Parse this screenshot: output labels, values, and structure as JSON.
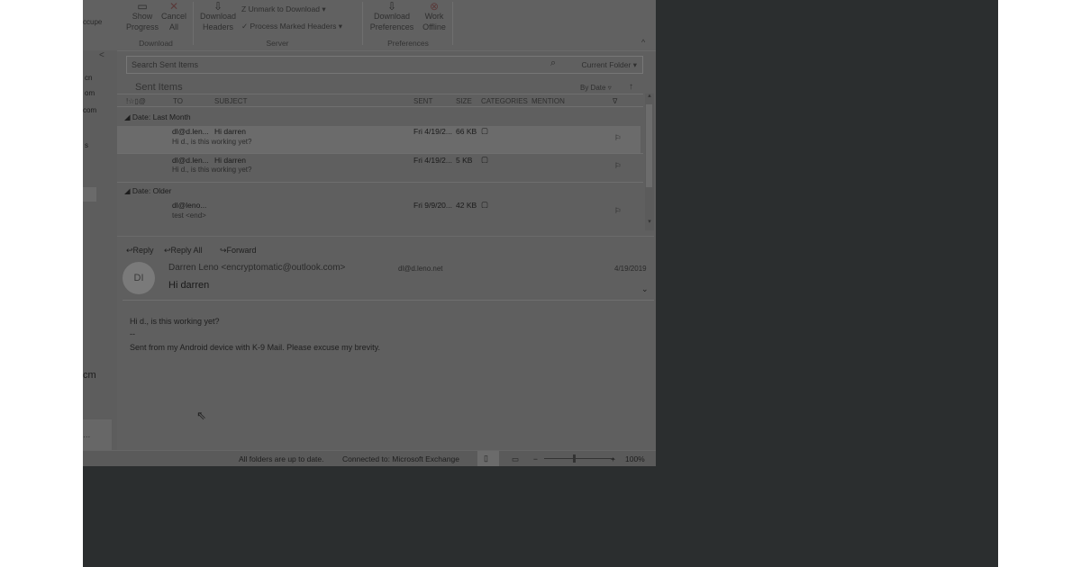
{
  "ribbon": {
    "show_progress": "Show Progress",
    "cancel_all": "Cancel All",
    "download_group": "Download",
    "download_headers": "Download Headers",
    "unmark_to_download": "Unmark to Download",
    "process_marked_headers": "Process Marked Headers",
    "server_group": "Server",
    "download_preferences": "Download Preferences",
    "work_offline": "Work Offline",
    "preferences_group": "Preferences",
    "left_cut_label": "ccupe"
  },
  "left_pane": {
    "items": [
      "cn",
      "om",
      "com",
      "s",
      "s"
    ],
    "bottom_item": "cm",
    "more": "..."
  },
  "search": {
    "placeholder": "Search Sent Items",
    "scope": "Current Folder"
  },
  "mail_list": {
    "folder_title": "Sent Items",
    "sort": "By Date",
    "columns": [
      "TO",
      "SUBJECT",
      "SENT",
      "SIZE",
      "CATEGORIES",
      "MENTION"
    ],
    "groups": [
      {
        "label": "Date: Last Month",
        "items": [
          {
            "to": "dl@d.len...",
            "subject": "Hi darren",
            "preview": "Hi d., is this working yet?",
            "sent": "Fri 4/19/2...",
            "size": "66 KB"
          },
          {
            "to": "dl@d.len...",
            "subject": "Hi darren",
            "preview": "Hi d., is this working yet?",
            "sent": "Fri 4/19/2...",
            "size": "5 KB"
          }
        ]
      },
      {
        "label": "Date: Older",
        "items": [
          {
            "to": "dl@leno...",
            "subject": "",
            "preview": "test <end>",
            "sent": "Fri 9/9/20...",
            "size": "42 KB"
          }
        ]
      }
    ]
  },
  "reading_pane": {
    "reply": "Reply",
    "reply_all": "Reply All",
    "forward": "Forward",
    "avatar_initials": "DI",
    "from": "Darren Leno <encryptomatic@outlook.com>",
    "to": "dl@d.leno.net",
    "date": "4/19/2019",
    "subject": "Hi darren",
    "body_line1": "Hi d., is this working yet?",
    "body_line2": "--",
    "body_line3": "Sent from my Android device with K-9 Mail. Please excuse my brevity."
  },
  "status_bar": {
    "folders_status": "All folders are up to date.",
    "connection": "Connected to: Microsoft Exchange",
    "zoom": "100%"
  },
  "colors": {
    "window": "#5f5f5f",
    "outer_dark": "#2b2e2f",
    "background": "#ffffff"
  }
}
